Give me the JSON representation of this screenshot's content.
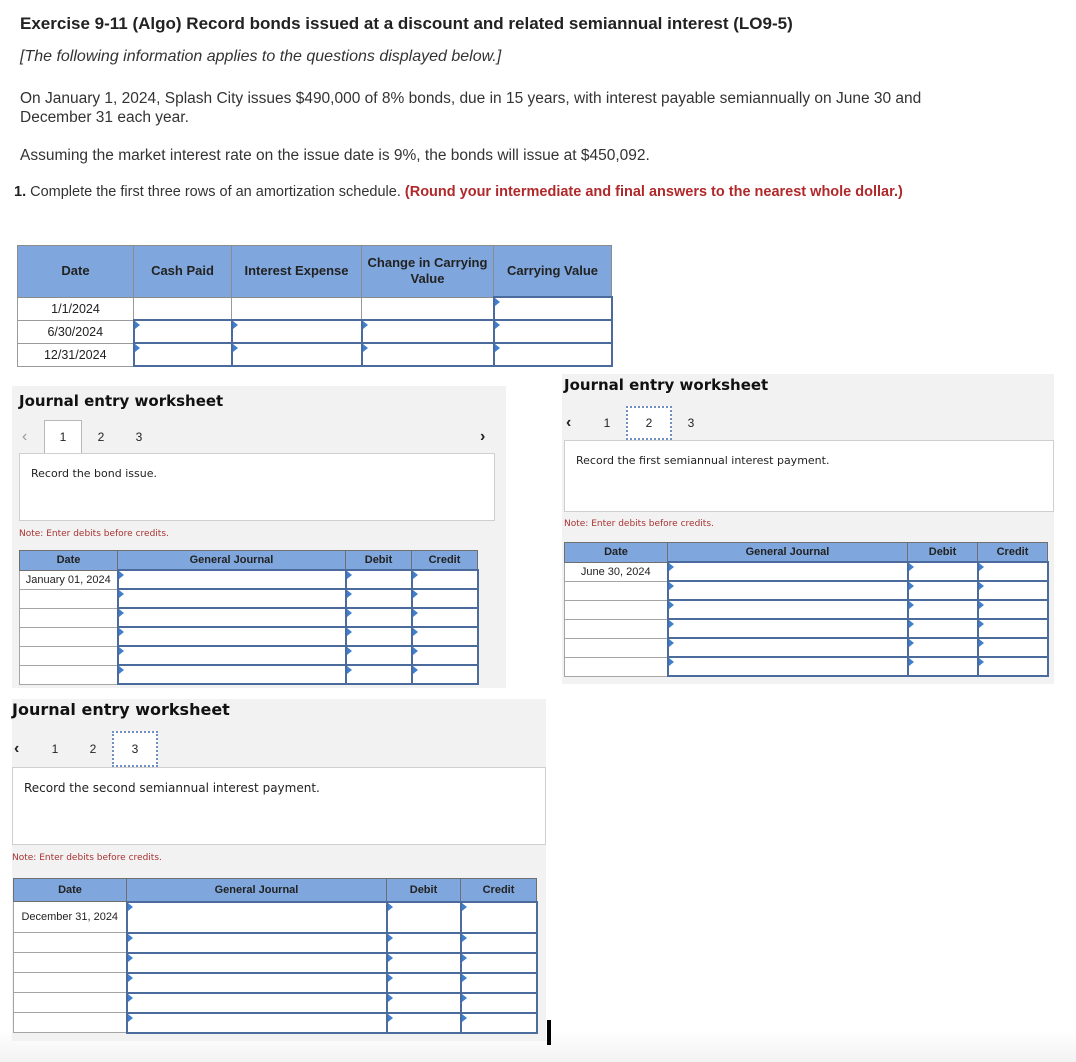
{
  "header": {
    "title": "Exercise 9-11 (Algo) Record bonds issued at a discount and related semiannual interest (LO9-5)",
    "intro": "[The following information applies to the questions displayed below.]",
    "paragraph1": "On January 1, 2024, Splash City issues $490,000 of 8% bonds, due in 15 years, with interest payable semiannually on June 30 and December 31 each year.",
    "paragraph2": "Assuming the market interest rate on the issue date is 9%, the bonds will issue at $450,092."
  },
  "question1": {
    "number": "1.",
    "text": " Complete the first three rows of an amortization schedule. ",
    "instruction": "(Round your intermediate and final answers to the nearest whole dollar.)"
  },
  "amortization": {
    "columns": [
      "Date",
      "Cash Paid",
      "Interest Expense",
      "Change in Carrying Value",
      "Carrying Value"
    ],
    "rows": [
      {
        "date": "1/1/2024",
        "cash_paid": "",
        "interest_expense": "",
        "change": "",
        "carrying_value": ""
      },
      {
        "date": "6/30/2024",
        "cash_paid": "",
        "interest_expense": "",
        "change": "",
        "carrying_value": ""
      },
      {
        "date": "12/31/2024",
        "cash_paid": "",
        "interest_expense": "",
        "change": "",
        "carrying_value": ""
      }
    ]
  },
  "worksheets": [
    {
      "title": "Journal entry worksheet",
      "tabs": [
        "1",
        "2",
        "3"
      ],
      "active_tab": "1",
      "prev_icon": "chevron-left",
      "next_icon": "chevron-right",
      "description": "Record the bond issue.",
      "note": "Note: Enter debits before credits.",
      "columns": [
        "Date",
        "General Journal",
        "Debit",
        "Credit"
      ],
      "rows": [
        {
          "date": "January 01, 2024",
          "account": "",
          "debit": "",
          "credit": ""
        },
        {
          "date": "",
          "account": "",
          "debit": "",
          "credit": ""
        },
        {
          "date": "",
          "account": "",
          "debit": "",
          "credit": ""
        },
        {
          "date": "",
          "account": "",
          "debit": "",
          "credit": ""
        },
        {
          "date": "",
          "account": "",
          "debit": "",
          "credit": ""
        },
        {
          "date": "",
          "account": "",
          "debit": "",
          "credit": ""
        }
      ]
    },
    {
      "title": "Journal entry worksheet",
      "tabs": [
        "1",
        "2",
        "3"
      ],
      "active_tab": "2",
      "prev_icon": "chevron-left",
      "description": "Record the first semiannual interest payment.",
      "note": "Note: Enter debits before credits.",
      "columns": [
        "Date",
        "General Journal",
        "Debit",
        "Credit"
      ],
      "rows": [
        {
          "date": "June 30, 2024",
          "account": "",
          "debit": "",
          "credit": ""
        },
        {
          "date": "",
          "account": "",
          "debit": "",
          "credit": ""
        },
        {
          "date": "",
          "account": "",
          "debit": "",
          "credit": ""
        },
        {
          "date": "",
          "account": "",
          "debit": "",
          "credit": ""
        },
        {
          "date": "",
          "account": "",
          "debit": "",
          "credit": ""
        },
        {
          "date": "",
          "account": "",
          "debit": "",
          "credit": ""
        }
      ]
    },
    {
      "title": "Journal entry worksheet",
      "tabs": [
        "1",
        "2",
        "3"
      ],
      "active_tab": "3",
      "prev_icon": "chevron-left",
      "description": "Record the second semiannual interest payment.",
      "note": "Note: Enter debits before credits.",
      "columns": [
        "Date",
        "General Journal",
        "Debit",
        "Credit"
      ],
      "rows": [
        {
          "date": "December 31, 2024",
          "account": "",
          "debit": "",
          "credit": ""
        },
        {
          "date": "",
          "account": "",
          "debit": "",
          "credit": ""
        },
        {
          "date": "",
          "account": "",
          "debit": "",
          "credit": ""
        },
        {
          "date": "",
          "account": "",
          "debit": "",
          "credit": ""
        },
        {
          "date": "",
          "account": "",
          "debit": "",
          "credit": ""
        },
        {
          "date": "",
          "account": "",
          "debit": "",
          "credit": ""
        }
      ]
    }
  ],
  "colors": {
    "header_blue": "#7fa7dd",
    "input_border": "#4b6b9c",
    "note_red": "#a83232",
    "instruction_red": "#b0282a"
  }
}
